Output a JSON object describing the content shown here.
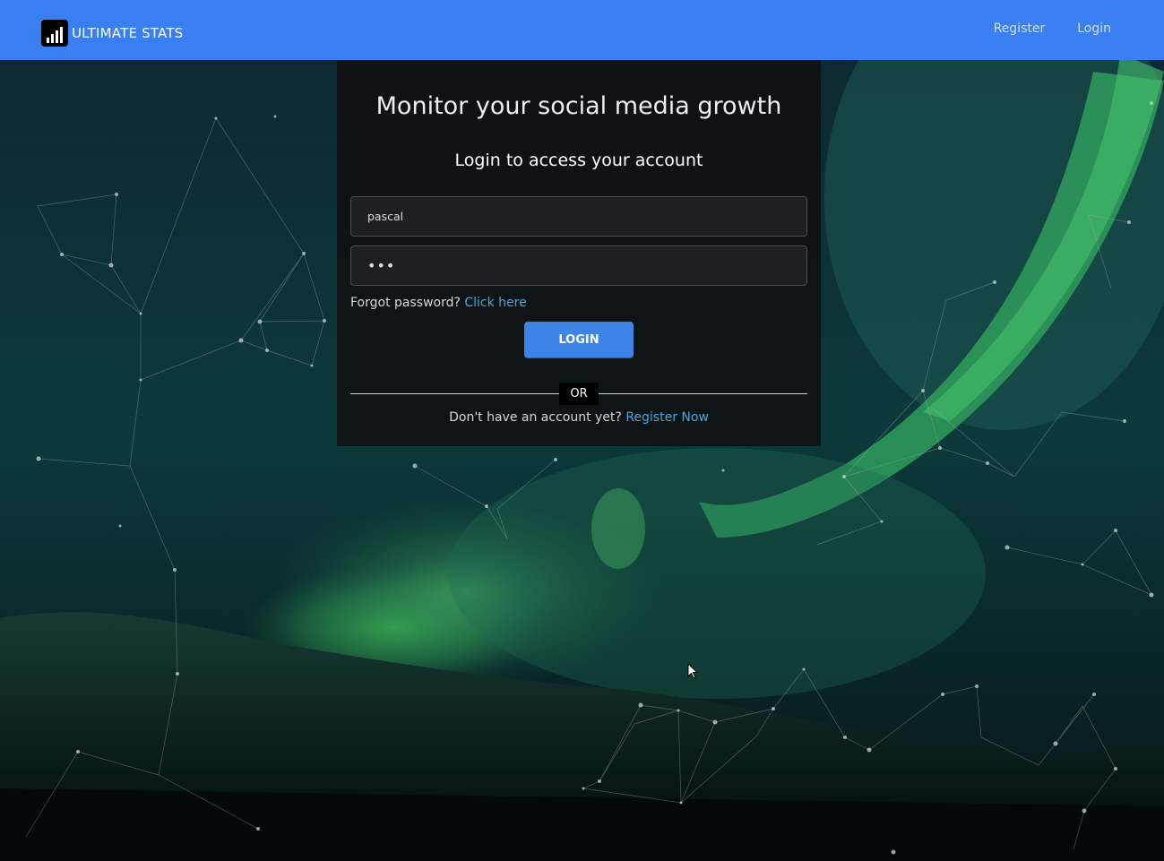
{
  "navbar": {
    "brand_text": "ULTIMATE STATS",
    "brand_icon": "bar-chart-icon",
    "links": [
      "Register",
      "Login"
    ]
  },
  "card": {
    "title": "Monitor your social media growth",
    "subtitle": "Login to access your account",
    "username_value": "pascal",
    "password_value": "•••",
    "forgot_text": "Forgot password?",
    "forgot_link": "Click here",
    "login_button": "LOGIN",
    "or_text": "OR",
    "register_prompt": "Don't have an account yet?",
    "register_link": "Register Now"
  },
  "colors": {
    "navbar": "#3a7ff2",
    "button": "#3d84e6",
    "link": "#4aa7d8",
    "card_bg": "#0e1012"
  }
}
